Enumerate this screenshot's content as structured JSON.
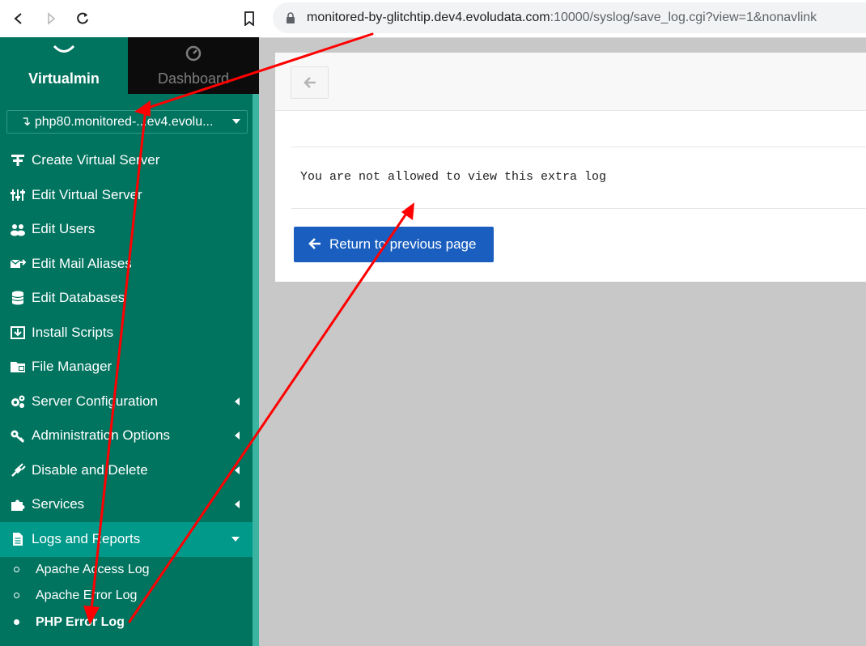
{
  "browser": {
    "url_host": "monitored-by-glitchtip.dev4.evoludata.com",
    "url_rest": ":10000/syslog/save_log.cgi?view=1&nonavlink"
  },
  "sidebar": {
    "tab_virtualmin": "Virtualmin",
    "tab_dashboard": "Dashboard",
    "domain_selected": "php80.monitored-...ev4.evolu...",
    "items": [
      {
        "label": "Create Virtual Server",
        "icon": "plus-icon"
      },
      {
        "label": "Edit Virtual Server",
        "icon": "sliders-icon"
      },
      {
        "label": "Edit Users",
        "icon": "users-icon"
      },
      {
        "label": "Edit Mail Aliases",
        "icon": "mail-forward-icon"
      },
      {
        "label": "Edit Databases",
        "icon": "database-icon"
      },
      {
        "label": "Install Scripts",
        "icon": "download-icon"
      },
      {
        "label": "File Manager",
        "icon": "folder-icon"
      },
      {
        "label": "Server Configuration",
        "icon": "gears-icon"
      },
      {
        "label": "Administration Options",
        "icon": "key-icon"
      },
      {
        "label": "Disable and Delete",
        "icon": "plug-icon"
      },
      {
        "label": "Services",
        "icon": "puzzle-icon"
      },
      {
        "label": "Logs and Reports",
        "icon": "file-icon"
      }
    ],
    "sub_items": [
      {
        "label": "Apache Access Log"
      },
      {
        "label": "Apache Error Log"
      },
      {
        "label": "PHP Error Log"
      }
    ]
  },
  "main": {
    "message": "You are not allowed to view this extra log",
    "return_button": "Return to previous page"
  },
  "colors": {
    "sidebar": "#00745f",
    "active": "#00998a",
    "button": "#1a5fbf",
    "annotation": "#ff0000"
  }
}
